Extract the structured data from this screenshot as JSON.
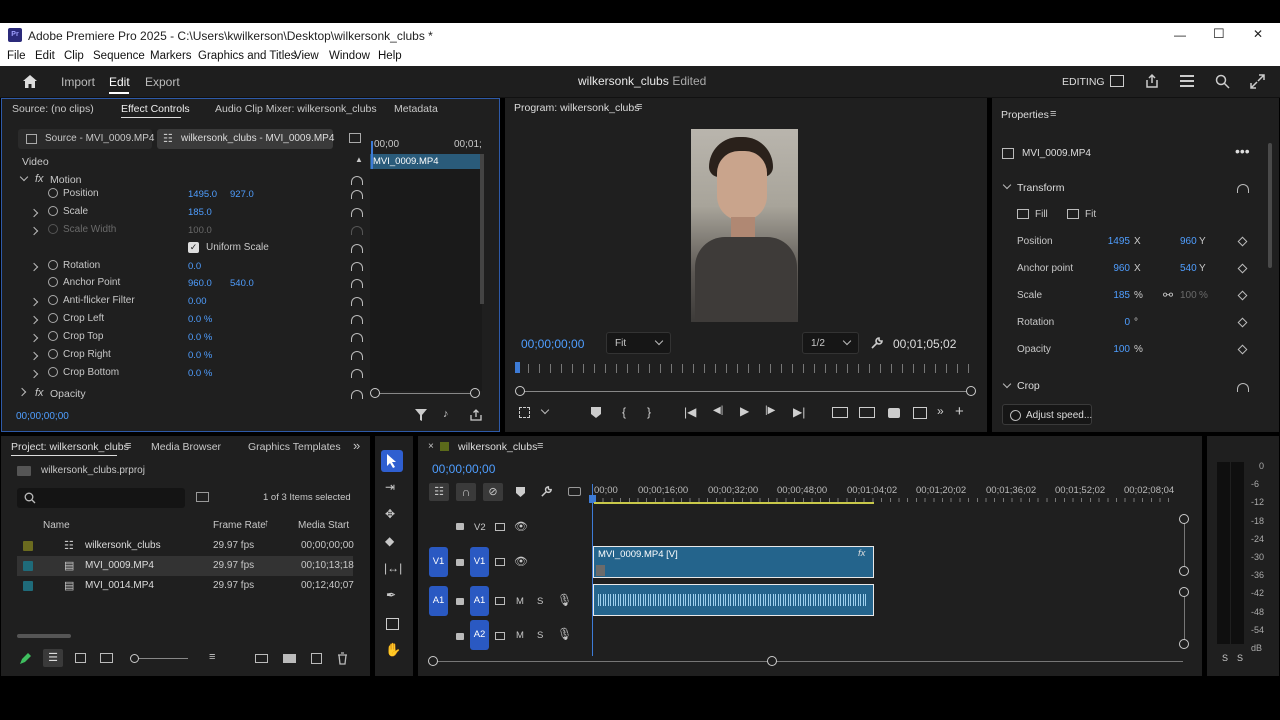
{
  "titlebar": {
    "title": "Adobe Premiere Pro 2025 - C:\\Users\\kwilkerson\\Desktop\\wilkersonk_clubs *",
    "minimize": "—",
    "maximize": "☐",
    "close": "✕"
  },
  "menu": [
    "File",
    "Edit",
    "Clip",
    "Sequence",
    "Markers",
    "Graphics and Titles",
    "View",
    "Window",
    "Help"
  ],
  "workbar": {
    "import": "Import",
    "edit": "Edit",
    "export": "Export",
    "project_title": "wilkersonk_clubs",
    "status": "- Edited",
    "workspace": "EDITING"
  },
  "source_panel": {
    "tabs": [
      "Source: (no clips)",
      "Effect Controls",
      "Audio Clip Mixer: wilkersonk_clubs",
      "Metadata"
    ],
    "source_chip": "Source - MVI_0009.MP4",
    "seq_chip": "wilkersonk_clubs - MVI_0009.MP4",
    "ruler_start": "00;00",
    "ruler_end": "00;01;",
    "clip_label": "MVI_0009.MP4",
    "section": "Video",
    "motion": "Motion",
    "rows": [
      {
        "label": "Position",
        "v1": "1495.0",
        "v2": "927.0"
      },
      {
        "label": "Scale",
        "v1": "185.0",
        "v2": ""
      },
      {
        "label": "Scale Width",
        "v1": "100.0",
        "v2": ""
      },
      {
        "label": "Uniform Scale",
        "v1": "",
        "v2": ""
      },
      {
        "label": "Rotation",
        "v1": "0.0",
        "v2": ""
      },
      {
        "label": "Anchor Point",
        "v1": "960.0",
        "v2": "540.0"
      },
      {
        "label": "Anti-flicker Filter",
        "v1": "0.00",
        "v2": ""
      },
      {
        "label": "Crop Left",
        "v1": "0.0 %",
        "v2": ""
      },
      {
        "label": "Crop Top",
        "v1": "0.0 %",
        "v2": ""
      },
      {
        "label": "Crop Right",
        "v1": "0.0 %",
        "v2": ""
      },
      {
        "label": "Crop Bottom",
        "v1": "0.0 %",
        "v2": ""
      }
    ],
    "opacity": "Opacity",
    "timecode": "00;00;00;00"
  },
  "program": {
    "title": "Program: wilkersonk_clubs",
    "timecode": "00;00;00;00",
    "fit": "Fit",
    "resolution": "1/2",
    "duration": "00;01;05;02"
  },
  "properties": {
    "title": "Properties",
    "clip": "MVI_0009.MP4",
    "transform": "Transform",
    "fill": "Fill",
    "fit": "Fit",
    "rows": [
      {
        "label": "Position",
        "v1": "1495",
        "u1": "X",
        "v2": "960",
        "u2": "Y"
      },
      {
        "label": "Anchor point",
        "v1": "960",
        "u1": "X",
        "v2": "540",
        "u2": "Y"
      },
      {
        "label": "Scale",
        "v1": "185",
        "u1": "%",
        "v2": "100",
        "u2": "%"
      },
      {
        "label": "Rotation",
        "v1": "0",
        "u1": "°",
        "v2": "",
        "u2": ""
      },
      {
        "label": "Opacity",
        "v1": "100",
        "u1": "%",
        "v2": "",
        "u2": ""
      }
    ],
    "crop": "Crop",
    "adjust_speed": "Adjust speed..."
  },
  "project": {
    "tabs": [
      "Project: wilkersonk_clubs",
      "Media Browser",
      "Graphics Templates"
    ],
    "file": "wilkersonk_clubs.prproj",
    "selection": "1 of 3 Items selected",
    "headers": {
      "name": "Name",
      "rate": "Frame Rate",
      "start": "Media Start"
    },
    "items": [
      {
        "name": "wilkersonk_clubs",
        "rate": "29.97 fps",
        "start": "00;00;00;00",
        "color": "#6b6b1f"
      },
      {
        "name": "MVI_0009.MP4",
        "rate": "29.97 fps",
        "start": "00;10;13;18",
        "color": "#1f6b7a"
      },
      {
        "name": "MVI_0014.MP4",
        "rate": "29.97 fps",
        "start": "00;12;40;07",
        "color": "#1f6b7a"
      }
    ]
  },
  "timeline": {
    "title": "wilkersonk_clubs",
    "timecode": "00;00;00;00",
    "ruler": [
      "00;00",
      "00;00;16;00",
      "00;00;32;00",
      "00;00;48;00",
      "00;01;04;02",
      "00;01;20;02",
      "00;01;36;02",
      "00;01;52;02",
      "00;02;08;04"
    ],
    "tracks": {
      "v2": "V2",
      "v1": "V1",
      "a1": "A1",
      "a2": "A2",
      "m": "M",
      "s": "S"
    },
    "video_clip": "MVI_0009.MP4 [V]",
    "fx": "fx"
  },
  "meter": {
    "scale": [
      "0",
      "-6",
      "-12",
      "-18",
      "-24",
      "-30",
      "-36",
      "-42",
      "-48",
      "-54",
      "dB"
    ],
    "footer": [
      "S",
      "S"
    ]
  }
}
